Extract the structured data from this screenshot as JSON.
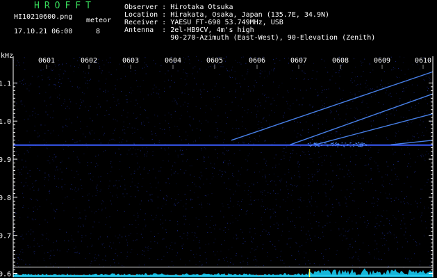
{
  "header": {
    "logo": "HROFFT",
    "filename": "HI10210600.png",
    "meteor_label": "meteor",
    "datetime": "17.10.21 06:00",
    "meteor_count": "8"
  },
  "info_lines": [
    "Observer : Hirotaka Otsuka",
    "Location : Hirakata, Osaka, Japan (135.7E, 34.9N)",
    "Receiver : YAESU FT-690 53.749MHz, USB",
    "Antenna  : 2el-HB9CV, 4m's high",
    "           90-270-Azimuth (East-West), 90-Elevation (Zenith)"
  ],
  "chart_data": {
    "type": "heatmap",
    "ylabel": "kHz",
    "x_ticks": [
      "0601",
      "0602",
      "0603",
      "0604",
      "0605",
      "0606",
      "0607",
      "0608",
      "0609",
      "0610"
    ],
    "y_ticks": [
      "1.1",
      "1.0",
      "0.9",
      "0.8",
      "0.7",
      "0.6"
    ],
    "ylim": [
      0.59,
      1.17
    ],
    "carrier_khz": 0.937,
    "reference_lines_khz": [
      0.617,
      0.595
    ],
    "streaks": [
      {
        "x0": 0.52,
        "y0": 0.62,
        "x1": 1.0,
        "y1": 0.93
      },
      {
        "x0": 0.66,
        "y0": 0.6,
        "x1": 1.0,
        "y1": 0.83
      },
      {
        "x0": 0.72,
        "y0": 0.6,
        "x1": 1.0,
        "y1": 0.74
      },
      {
        "x0": 0.9,
        "y0": 0.6,
        "x1": 1.0,
        "y1": 0.62
      }
    ],
    "colors": {
      "background": "#000000",
      "noise": "#1b2a8c",
      "carrier": "#3a5cff",
      "signal": "#4f8dff",
      "baseline": "#19d6ff",
      "axis": "#ffffff"
    }
  }
}
